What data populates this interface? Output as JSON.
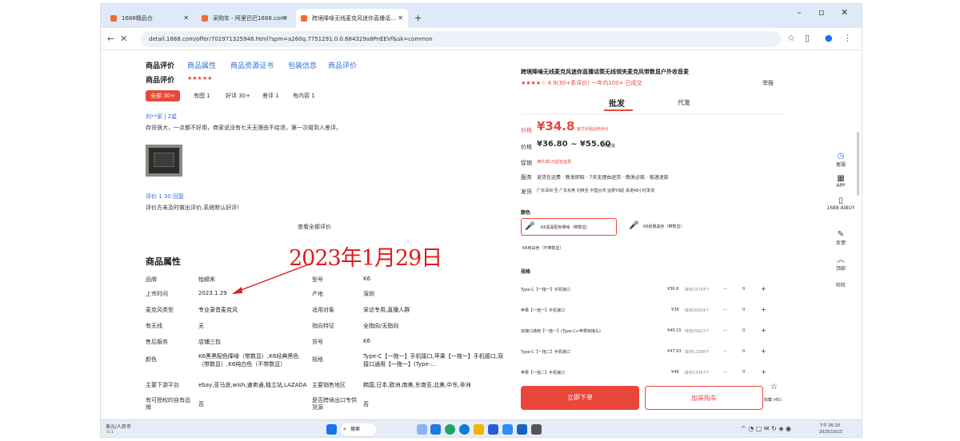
{
  "browser": {
    "tabs": [
      {
        "label": "1688精品仓",
        "active": false
      },
      {
        "label": "采购车 - 阿里巴巴1688.com",
        "active": false
      },
      {
        "label": "跨境降噪无线麦克风迷你直播话…",
        "active": true
      }
    ],
    "url": "detail.1688.com/offer/702971325948.html?spm=a260q.7751291.0.0.684329a8PnEEVf&sk=common"
  },
  "left": {
    "tabs": [
      "商品评价",
      "商品属性",
      "商品资源证书",
      "包装信息",
      "商品评价"
    ],
    "rating_header": "商品评价",
    "filters": [
      {
        "label": "全部 30+",
        "active": true
      },
      {
        "label": "有图 1",
        "active": false
      },
      {
        "label": "好评 30+",
        "active": false
      },
      {
        "label": "差评 1",
        "active": false
      },
      {
        "label": "有内容 1",
        "active": false
      }
    ],
    "review1_user": "刘**家 | 2星",
    "review1_text": "存货很大，一点都不好用，商家说没有七天无理由不给退，第一次碰到人差评。",
    "review2_user": "评价 1 30 回复",
    "review2_text": "评价方未及时做出评价,系统默认好评!",
    "view_all": "查看全部评价",
    "props_title": "商品属性",
    "props": [
      [
        "品牌",
        "怡顺禾",
        "型号",
        "K6"
      ],
      [
        "上市时间",
        "2023.1.29",
        "产地",
        "深圳"
      ],
      [
        "麦克风类型",
        "专业录音麦克风",
        "适用对象",
        "采访专用,直播人群"
      ],
      [
        "有无线",
        "无",
        "指向特征",
        "全指向/无指向"
      ],
      [
        "售后服务",
        "店铺三包",
        "货号",
        "K6"
      ],
      [
        "颜色",
        "K6黑黑配色降噪（带数显）,K6经典黑色（带数显）,K6纯白色（不带数显）",
        "规格",
        "Type-C【一拖一】手机接口,苹果【一拖一】手机接口,双接口通用【一拖一】(Type-..."
      ],
      [
        "主要下游平台",
        "ebay,亚马逊,wish,速卖通,独立站,LAZADA",
        "主要销售地区",
        "韩国,日本,欧洲,南美,东南亚,北美,中东,非洲"
      ],
      [
        "有可授权的自有品牌",
        "否",
        "是否跨境出口专供货源",
        "否"
      ]
    ],
    "annotation": "2023年1月29日"
  },
  "right": {
    "title": "跨境降噪无线麦克风迷你直播话筒无线领夹麦克风带数显户外收音麦",
    "meta": "★★★★☆ 4.9(30+条评价)   一年内100+ 已成交",
    "report": "举报",
    "tab_wholesale": "批发",
    "tab_dropship": "代发",
    "price_label": "价格",
    "price": "¥34.8",
    "price_note": "官方补贴后到手价",
    "range_label": "价格",
    "range": "¥36.80 ~ ¥55.60",
    "range_unit": "1件起批",
    "promo_label": "促销",
    "promo": "满件减1元起包运费",
    "service_label": "服务",
    "service": "退货包运费 · 晚发即赔 · 7天无理由退货 · 晚发必赔 · 极速退款",
    "ship_label": "发货",
    "ship": "广东深圳 至 广东东莞  切换至 中国台湾  运费¥3起  承诺48小时发货",
    "color_label": "颜色",
    "colors": [
      "K6黑黑配色降噪（带数显）",
      "K6经典黑色（带数显）",
      "K6纯白色（不带数显）"
    ],
    "spec_label": "规格",
    "specs": [
      {
        "name": "Type-C【一拖一】手机接口",
        "price": "¥36.8",
        "stock": "库存23754个",
        "qty": "0"
      },
      {
        "name": "苹果【一拖一】手机接口",
        "price": "¥38",
        "stock": "库存20934个",
        "qty": "0"
      },
      {
        "name": "双接口通用【一拖一】(Type-C+苹果转接头)",
        "price": "¥40.15",
        "stock": "库存25623个",
        "qty": "0"
      },
      {
        "name": "Type-C【一拖二】手机接口",
        "price": "¥47.93",
        "stock": "库存12398个",
        "qty": "0"
      },
      {
        "name": "苹果【一拖二】手机接口",
        "price": "¥48",
        "stock": "库存13457个",
        "qty": "0"
      }
    ],
    "buy_now": "立即下单",
    "add_cart": "加采购车",
    "collect": "收藏 (45)"
  },
  "sidebar": [
    {
      "icon": "clock-icon",
      "label": "客服"
    },
    {
      "icon": "qr-icon",
      "label": "APP"
    },
    {
      "icon": "phone-icon",
      "label": "1688 AIBUY"
    },
    {
      "icon": "edit-icon",
      "label": "反馈"
    },
    {
      "icon": "up-icon",
      "label": "顶部"
    },
    {
      "icon": "",
      "label": "旺旺"
    }
  ],
  "taskbar": {
    "search": "搜索",
    "left_text": "美元/人民币",
    "left_sub": "-0.1",
    "time": "下午 05:20",
    "date": "2025/10/23"
  }
}
